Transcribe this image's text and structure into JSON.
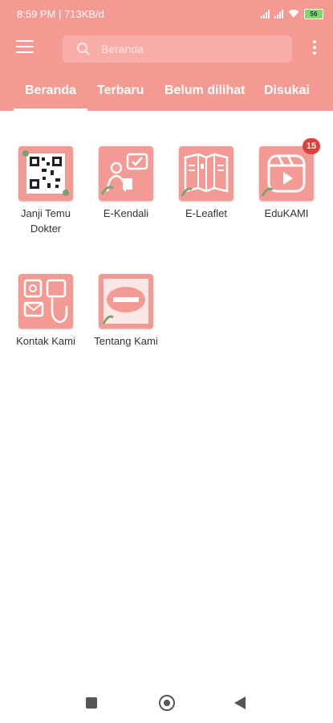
{
  "status_bar": {
    "time_info": "8:59 PM | 713KB/d",
    "battery": "56"
  },
  "search": {
    "placeholder": "Beranda"
  },
  "tabs": [
    {
      "label": "Beranda",
      "active": true
    },
    {
      "label": "Terbaru"
    },
    {
      "label": "Belum dilihat"
    },
    {
      "label": "Disukai"
    }
  ],
  "apps": [
    {
      "label": "Janji Temu Dokter",
      "icon": "qr-code-icon"
    },
    {
      "label": "E-Kendali",
      "icon": "person-chat-icon"
    },
    {
      "label": "E-Leaflet",
      "icon": "leaflet-icon"
    },
    {
      "label": "EduKAMI",
      "icon": "video-play-icon",
      "badge": "15"
    },
    {
      "label": "Kontak Kami",
      "icon": "contact-icon"
    },
    {
      "label": "Tentang Kami",
      "icon": "about-logo-icon"
    }
  ],
  "colors": {
    "header": "#f59a93",
    "badge": "#e0403a"
  }
}
